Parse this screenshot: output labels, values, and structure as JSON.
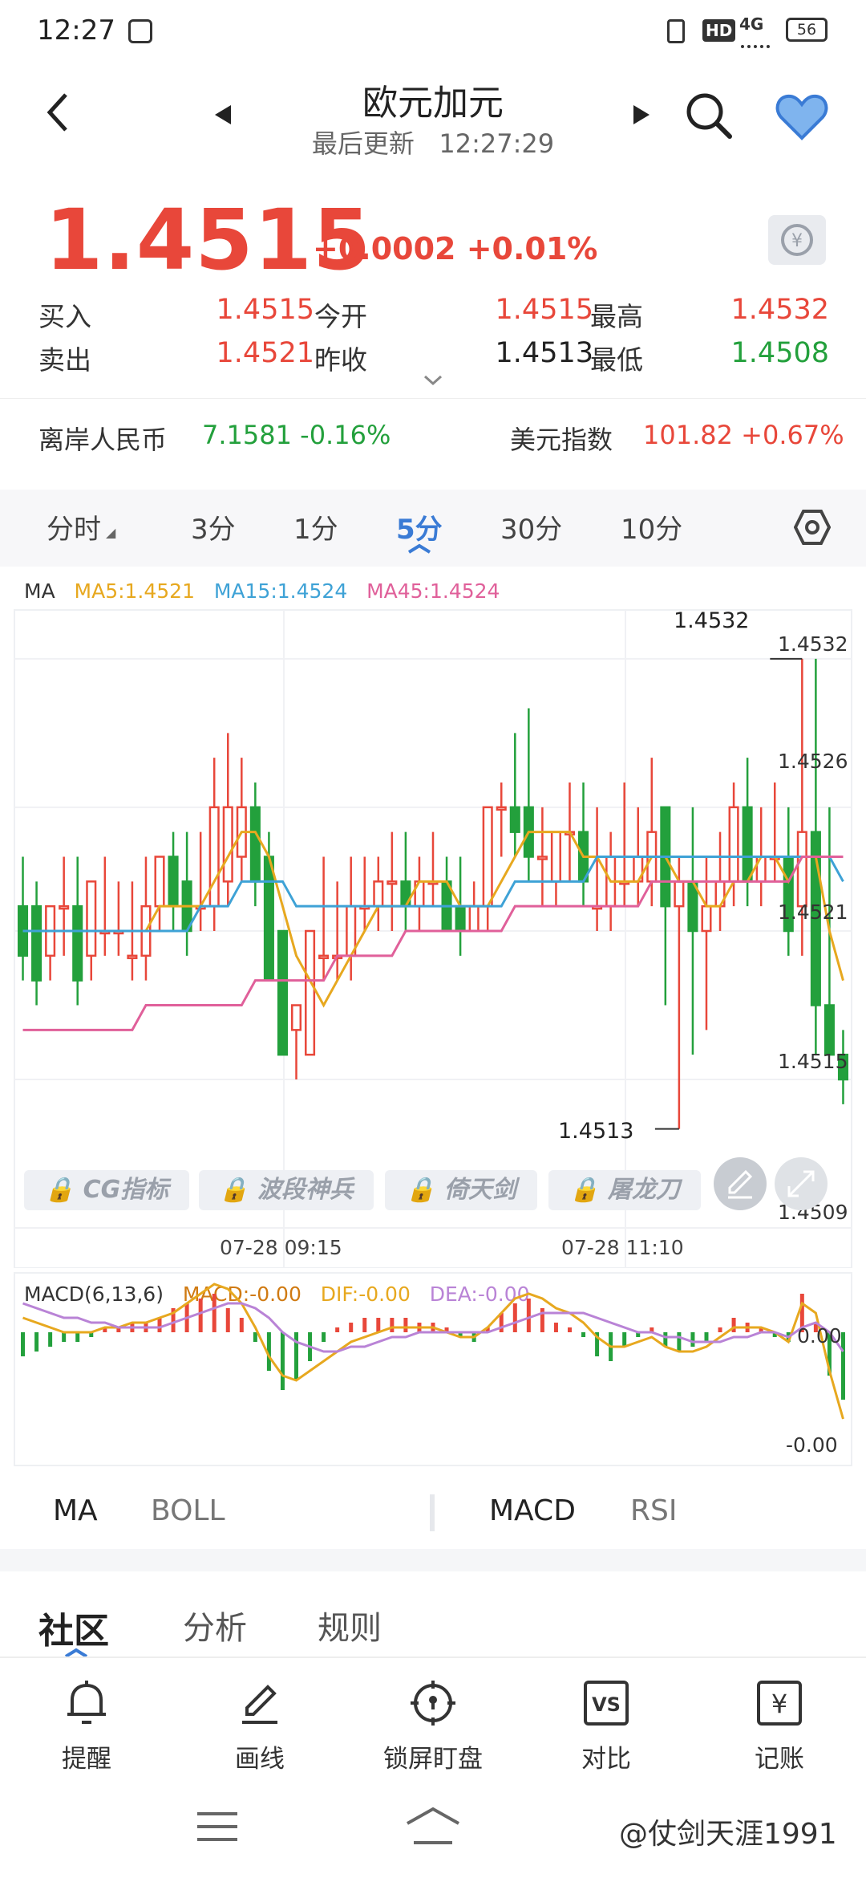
{
  "status_bar": {
    "time": "12:27",
    "battery": "56",
    "network": "4G",
    "hd": "HD"
  },
  "header": {
    "title": "欧元加元",
    "update_label": "最后更新",
    "update_time": "12:27:29"
  },
  "quote": {
    "price": "1.4515",
    "change": "+0.0002 +0.01%",
    "rows": [
      {
        "l1": "买入",
        "v1": "1.4515",
        "l2": "今开",
        "v2": "1.4515",
        "l3": "最高",
        "v3": "1.4532"
      },
      {
        "l1": "卖出",
        "v1": "1.4521",
        "l2": "昨收",
        "v2": "1.4513",
        "l3": "最低",
        "v3": "1.4508"
      }
    ]
  },
  "related": {
    "cnh_label": "离岸人民币",
    "cnh_value": "7.1581 -0.16%",
    "dxy_label": "美元指数",
    "dxy_value": "101.82 +0.67%"
  },
  "periods": [
    "分时",
    "3分",
    "1分",
    "5分",
    "30分",
    "10分"
  ],
  "active_period": "5分",
  "legend": {
    "ma": "MA",
    "ma5": "MA5:1.4521",
    "ma15": "MA15:1.4524",
    "ma45": "MA45:1.4524"
  },
  "axis_labels": {
    "y1": "1.4532",
    "y2": "1.4526",
    "y3": "1.4521",
    "y4": "1.4515",
    "y5": "1.4509",
    "high_mark": "1.4532",
    "low_mark": "1.4513",
    "t1": "07-28 09:15",
    "t2": "07-28 11:10"
  },
  "indicator_buttons": [
    "CG指标",
    "波段神兵",
    "倚天剑",
    "屠龙刀"
  ],
  "macd_legend": {
    "name": "MACD(6,13,6)",
    "macd": "MACD:-0.00",
    "dif": "DIF:-0.00",
    "dea": "DEA:-0.00",
    "top": "0.00",
    "bottom": "-0.00"
  },
  "indicator_tabs": {
    "left1": "MA",
    "left2": "BOLL",
    "right1": "MACD",
    "right2": "RSI"
  },
  "community_tabs": [
    "社区",
    "分析",
    "规则"
  ],
  "bottom_nav": [
    "提醒",
    "画线",
    "锁屏盯盘",
    "对比",
    "记账"
  ],
  "watermark": "@仗剑天涯1991",
  "colors": {
    "up": "#e8473a",
    "down": "#23a03c",
    "accent": "#3a7bd5",
    "ma5": "#e7a81f",
    "ma15": "#3ea2d6",
    "ma45": "#e0609a"
  },
  "chart_data": {
    "type": "candlestick",
    "ylim": [
      1.4509,
      1.4533
    ],
    "candles": [
      {
        "o": 1.4522,
        "h": 1.4524,
        "c": 1.452,
        "l": 1.4519
      },
      {
        "o": 1.4522,
        "h": 1.4523,
        "c": 1.4519,
        "l": 1.4518
      },
      {
        "o": 1.452,
        "h": 1.4522,
        "c": 1.4522,
        "l": 1.4519
      },
      {
        "o": 1.4522,
        "h": 1.4524,
        "c": 1.4522,
        "l": 1.452
      },
      {
        "o": 1.4522,
        "h": 1.4524,
        "c": 1.4519,
        "l": 1.4518
      },
      {
        "o": 1.452,
        "h": 1.4523,
        "c": 1.4523,
        "l": 1.4519
      },
      {
        "o": 1.4521,
        "h": 1.4524,
        "c": 1.4521,
        "l": 1.452
      },
      {
        "o": 1.4521,
        "h": 1.4523,
        "c": 1.4521,
        "l": 1.452
      },
      {
        "o": 1.452,
        "h": 1.4523,
        "c": 1.452,
        "l": 1.4519
      },
      {
        "o": 1.452,
        "h": 1.4524,
        "c": 1.4522,
        "l": 1.4519
      },
      {
        "o": 1.4522,
        "h": 1.4524,
        "c": 1.4524,
        "l": 1.4521
      },
      {
        "o": 1.4524,
        "h": 1.4525,
        "c": 1.4522,
        "l": 1.4521
      },
      {
        "o": 1.4523,
        "h": 1.4525,
        "c": 1.4521,
        "l": 1.452
      },
      {
        "o": 1.4522,
        "h": 1.4525,
        "c": 1.4522,
        "l": 1.4521
      },
      {
        "o": 1.4522,
        "h": 1.4528,
        "c": 1.4526,
        "l": 1.4521
      },
      {
        "o": 1.4523,
        "h": 1.4529,
        "c": 1.4526,
        "l": 1.4522
      },
      {
        "o": 1.4524,
        "h": 1.4528,
        "c": 1.4526,
        "l": 1.4523
      },
      {
        "o": 1.4526,
        "h": 1.4527,
        "c": 1.4523,
        "l": 1.4522
      },
      {
        "o": 1.4524,
        "h": 1.4525,
        "c": 1.4519,
        "l": 1.4519
      },
      {
        "o": 1.4521,
        "h": 1.4521,
        "c": 1.4516,
        "l": 1.4516
      },
      {
        "o": 1.4517,
        "h": 1.4518,
        "c": 1.4518,
        "l": 1.4515
      },
      {
        "o": 1.4516,
        "h": 1.452,
        "c": 1.4521,
        "l": 1.4516
      },
      {
        "o": 1.452,
        "h": 1.4524,
        "c": 1.452,
        "l": 1.4519
      },
      {
        "o": 1.452,
        "h": 1.4523,
        "c": 1.452,
        "l": 1.4519
      },
      {
        "o": 1.452,
        "h": 1.4524,
        "c": 1.4522,
        "l": 1.4519
      },
      {
        "o": 1.4522,
        "h": 1.4524,
        "c": 1.4522,
        "l": 1.4521
      },
      {
        "o": 1.4522,
        "h": 1.4524,
        "c": 1.4523,
        "l": 1.4521
      },
      {
        "o": 1.4523,
        "h": 1.4525,
        "c": 1.4523,
        "l": 1.4521
      },
      {
        "o": 1.4523,
        "h": 1.4525,
        "c": 1.4522,
        "l": 1.4521
      },
      {
        "o": 1.4522,
        "h": 1.4524,
        "c": 1.4523,
        "l": 1.4521
      },
      {
        "o": 1.4523,
        "h": 1.4525,
        "c": 1.4523,
        "l": 1.4522
      },
      {
        "o": 1.4523,
        "h": 1.4524,
        "c": 1.4521,
        "l": 1.4521
      },
      {
        "o": 1.4522,
        "h": 1.4524,
        "c": 1.4521,
        "l": 1.452
      },
      {
        "o": 1.4521,
        "h": 1.4523,
        "c": 1.4522,
        "l": 1.4521
      },
      {
        "o": 1.4522,
        "h": 1.4526,
        "c": 1.4526,
        "l": 1.4521
      },
      {
        "o": 1.4526,
        "h": 1.4527,
        "c": 1.4526,
        "l": 1.4524
      },
      {
        "o": 1.4526,
        "h": 1.4529,
        "c": 1.4525,
        "l": 1.4524
      },
      {
        "o": 1.4526,
        "h": 1.453,
        "c": 1.4524,
        "l": 1.4523
      },
      {
        "o": 1.4524,
        "h": 1.4526,
        "c": 1.4524,
        "l": 1.4522
      },
      {
        "o": 1.4523,
        "h": 1.4525,
        "c": 1.4525,
        "l": 1.4522
      },
      {
        "o": 1.4525,
        "h": 1.4527,
        "c": 1.4525,
        "l": 1.4523
      },
      {
        "o": 1.4525,
        "h": 1.4527,
        "c": 1.4523,
        "l": 1.4522
      },
      {
        "o": 1.4522,
        "h": 1.4526,
        "c": 1.4522,
        "l": 1.4521
      },
      {
        "o": 1.4522,
        "h": 1.4525,
        "c": 1.4524,
        "l": 1.4521
      },
      {
        "o": 1.4523,
        "h": 1.4527,
        "c": 1.4523,
        "l": 1.4522
      },
      {
        "o": 1.4523,
        "h": 1.4526,
        "c": 1.4524,
        "l": 1.4522
      },
      {
        "o": 1.4523,
        "h": 1.4528,
        "c": 1.4525,
        "l": 1.4522
      },
      {
        "o": 1.4526,
        "h": 1.4526,
        "c": 1.4522,
        "l": 1.4518
      },
      {
        "o": 1.4522,
        "h": 1.4524,
        "c": 1.4523,
        "l": 1.4513
      },
      {
        "o": 1.4523,
        "h": 1.4526,
        "c": 1.4521,
        "l": 1.4516
      },
      {
        "o": 1.4521,
        "h": 1.4524,
        "c": 1.4522,
        "l": 1.4517
      },
      {
        "o": 1.4522,
        "h": 1.4525,
        "c": 1.4523,
        "l": 1.4521
      },
      {
        "o": 1.4523,
        "h": 1.4527,
        "c": 1.4526,
        "l": 1.4522
      },
      {
        "o": 1.4526,
        "h": 1.4528,
        "c": 1.4523,
        "l": 1.4522
      },
      {
        "o": 1.4523,
        "h": 1.4526,
        "c": 1.4524,
        "l": 1.4522
      },
      {
        "o": 1.4524,
        "h": 1.4527,
        "c": 1.4524,
        "l": 1.4523
      },
      {
        "o": 1.4524,
        "h": 1.4526,
        "c": 1.4521,
        "l": 1.452
      },
      {
        "o": 1.4522,
        "h": 1.4532,
        "c": 1.4525,
        "l": 1.452
      },
      {
        "o": 1.4525,
        "h": 1.4532,
        "c": 1.4518,
        "l": 1.4516
      },
      {
        "o": 1.4518,
        "h": 1.4526,
        "c": 1.4516,
        "l": 1.4516
      },
      {
        "o": 1.4516,
        "h": 1.4517,
        "c": 1.4515,
        "l": 1.4514
      }
    ],
    "ma5": [
      1.4521,
      1.4521,
      1.4521,
      1.4521,
      1.4521,
      1.4521,
      1.4521,
      1.4521,
      1.4521,
      1.4521,
      1.4522,
      1.4522,
      1.4522,
      1.4522,
      1.4523,
      1.4524,
      1.4525,
      1.4525,
      1.4524,
      1.4522,
      1.452,
      1.4519,
      1.4518,
      1.4519,
      1.452,
      1.4521,
      1.4522,
      1.4522,
      1.4522,
      1.4523,
      1.4523,
      1.4523,
      1.4522,
      1.4522,
      1.4522,
      1.4523,
      1.4524,
      1.4525,
      1.4525,
      1.4525,
      1.4525,
      1.4524,
      1.4524,
      1.4523,
      1.4523,
      1.4523,
      1.4524,
      1.4524,
      1.4523,
      1.4523,
      1.4522,
      1.4522,
      1.4523,
      1.4523,
      1.4524,
      1.4524,
      1.4523,
      1.4524,
      1.4524,
      1.4521,
      1.4519
    ],
    "ma15": [
      1.4521,
      1.4521,
      1.4521,
      1.4521,
      1.4521,
      1.4521,
      1.4521,
      1.4521,
      1.4521,
      1.4521,
      1.4521,
      1.4521,
      1.4521,
      1.4522,
      1.4522,
      1.4522,
      1.4523,
      1.4523,
      1.4523,
      1.4523,
      1.4522,
      1.4522,
      1.4522,
      1.4522,
      1.4522,
      1.4522,
      1.4522,
      1.4522,
      1.4522,
      1.4522,
      1.4522,
      1.4522,
      1.4522,
      1.4522,
      1.4522,
      1.4522,
      1.4523,
      1.4523,
      1.4523,
      1.4523,
      1.4523,
      1.4523,
      1.4524,
      1.4524,
      1.4524,
      1.4524,
      1.4524,
      1.4524,
      1.4524,
      1.4524,
      1.4524,
      1.4524,
      1.4524,
      1.4524,
      1.4524,
      1.4524,
      1.4524,
      1.4524,
      1.4524,
      1.4524,
      1.4523
    ],
    "ma45": [
      1.4517,
      1.4517,
      1.4517,
      1.4517,
      1.4517,
      1.4517,
      1.4517,
      1.4517,
      1.4517,
      1.4518,
      1.4518,
      1.4518,
      1.4518,
      1.4518,
      1.4518,
      1.4518,
      1.4518,
      1.4519,
      1.4519,
      1.4519,
      1.4519,
      1.4519,
      1.4519,
      1.452,
      1.452,
      1.452,
      1.452,
      1.452,
      1.4521,
      1.4521,
      1.4521,
      1.4521,
      1.4521,
      1.4521,
      1.4521,
      1.4521,
      1.4522,
      1.4522,
      1.4522,
      1.4522,
      1.4522,
      1.4522,
      1.4522,
      1.4522,
      1.4522,
      1.4522,
      1.4523,
      1.4523,
      1.4523,
      1.4523,
      1.4523,
      1.4523,
      1.4523,
      1.4523,
      1.4523,
      1.4523,
      1.4523,
      1.4524,
      1.4524,
      1.4524,
      1.4524
    ],
    "macd_hist": [
      -0.5,
      -0.4,
      -0.3,
      -0.2,
      -0.2,
      -0.1,
      0.1,
      0.1,
      0.2,
      0.2,
      0.3,
      0.5,
      0.6,
      0.7,
      0.8,
      0.5,
      0.3,
      -0.2,
      -0.8,
      -1.2,
      -1.0,
      -0.6,
      -0.2,
      0.1,
      0.2,
      0.3,
      0.3,
      0.3,
      0.3,
      0.2,
      0.2,
      0.1,
      -0.1,
      -0.2,
      0.1,
      0.4,
      0.6,
      0.7,
      0.5,
      0.2,
      0.1,
      -0.1,
      -0.5,
      -0.6,
      -0.3,
      -0.1,
      0.1,
      -0.3,
      -0.4,
      -0.3,
      -0.2,
      0.1,
      0.3,
      0.2,
      0.1,
      -0.1,
      -0.2,
      0.8,
      0.2,
      -0.9,
      -1.4
    ],
    "dif": [
      0.3,
      0.2,
      0.1,
      0.0,
      0.0,
      0.0,
      0.1,
      0.1,
      0.2,
      0.2,
      0.3,
      0.4,
      0.6,
      0.8,
      1.0,
      0.9,
      0.6,
      0.1,
      -0.5,
      -0.9,
      -1.0,
      -0.8,
      -0.6,
      -0.4,
      -0.2,
      -0.1,
      0.0,
      0.1,
      0.1,
      0.1,
      0.1,
      0.0,
      -0.1,
      -0.1,
      0.1,
      0.4,
      0.7,
      0.8,
      0.7,
      0.5,
      0.4,
      0.2,
      -0.1,
      -0.3,
      -0.3,
      -0.2,
      -0.1,
      -0.3,
      -0.4,
      -0.4,
      -0.3,
      -0.1,
      0.1,
      0.1,
      0.1,
      0.0,
      -0.2,
      0.6,
      0.4,
      -0.8,
      -1.8
    ],
    "dea": [
      0.6,
      0.5,
      0.4,
      0.3,
      0.3,
      0.2,
      0.2,
      0.1,
      0.1,
      0.1,
      0.1,
      0.2,
      0.3,
      0.4,
      0.5,
      0.6,
      0.6,
      0.5,
      0.3,
      0.0,
      -0.2,
      -0.3,
      -0.4,
      -0.4,
      -0.3,
      -0.3,
      -0.2,
      -0.1,
      -0.1,
      0.0,
      0.0,
      0.0,
      0.0,
      0.0,
      0.0,
      0.1,
      0.2,
      0.3,
      0.4,
      0.4,
      0.4,
      0.4,
      0.3,
      0.2,
      0.1,
      0.0,
      0.0,
      -0.1,
      -0.1,
      -0.2,
      -0.2,
      -0.2,
      -0.1,
      -0.1,
      0.0,
      0.0,
      -0.1,
      0.1,
      0.2,
      0.0,
      -0.4
    ]
  }
}
